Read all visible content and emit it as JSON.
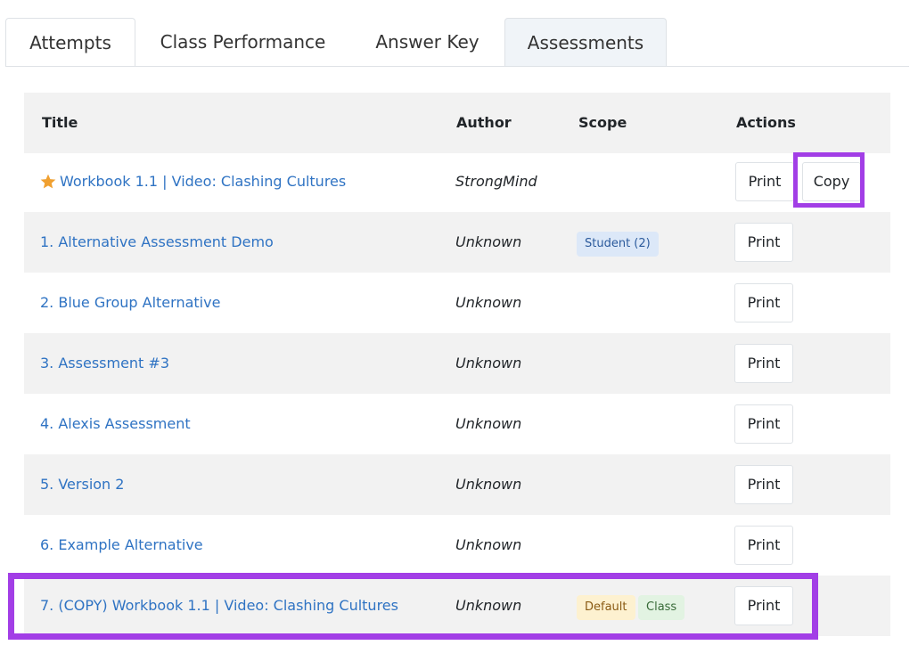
{
  "tabs": [
    {
      "label": "Attempts",
      "active": false
    },
    {
      "label": "Class Performance",
      "active": false
    },
    {
      "label": "Answer Key",
      "active": false
    },
    {
      "label": "Assessments",
      "active": true
    }
  ],
  "table": {
    "headers": {
      "title": "Title",
      "author": "Author",
      "scope": "Scope",
      "actions": "Actions"
    },
    "rows": [
      {
        "title": "Workbook 1.1 | Video: Clashing Cultures",
        "author": "StrongMind",
        "starred": true,
        "scope": [],
        "print_label": "Print",
        "copy_label": "Copy"
      },
      {
        "title": "1. Alternative Assessment Demo",
        "author": "Unknown",
        "scope": [
          "Student (2)"
        ],
        "print_label": "Print"
      },
      {
        "title": "2. Blue Group Alternative",
        "author": "Unknown",
        "scope": [],
        "print_label": "Print"
      },
      {
        "title": "3. Assessment #3",
        "author": "Unknown",
        "scope": [],
        "print_label": "Print"
      },
      {
        "title": "4. Alexis Assessment",
        "author": "Unknown",
        "scope": [],
        "print_label": "Print"
      },
      {
        "title": "5. Version 2",
        "author": "Unknown",
        "scope": [],
        "print_label": "Print"
      },
      {
        "title": "6. Example Alternative",
        "author": "Unknown",
        "scope": [],
        "print_label": "Print"
      },
      {
        "title": "7. (COPY) Workbook 1.1 | Video: Clashing Cultures",
        "author": "Unknown",
        "scope": [
          "Default",
          "Class"
        ],
        "print_label": "Print"
      }
    ]
  },
  "colors": {
    "link": "#2f73c3",
    "highlight": "#a23ee6",
    "star": "#f0a030"
  }
}
